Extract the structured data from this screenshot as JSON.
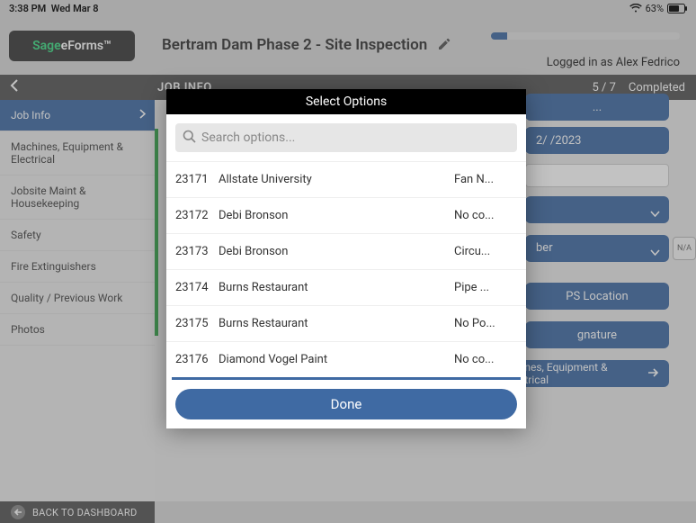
{
  "status": {
    "time": "3:38 PM",
    "date": "Wed Mar 8",
    "battery": "63%"
  },
  "app": {
    "logo_sage": "Sage",
    "logo_rest": " eForms™"
  },
  "page": {
    "title": "Bertram Dam Phase 2 - Site Inspection",
    "logged_in": "Logged in as Alex Fedrico"
  },
  "topbar": {
    "section": "JOB INFO",
    "progress": "5 / 7",
    "status": "Completed"
  },
  "sidebar": {
    "items": [
      {
        "label": "Job Info",
        "active": true
      },
      {
        "label": "Machines, Equipment & Electrical"
      },
      {
        "label": "Jobsite Maint & Housekeeping"
      },
      {
        "label": "Safety"
      },
      {
        "label": "Fire Extinguishers"
      },
      {
        "label": "Quality / Previous Work"
      },
      {
        "label": "Photos"
      }
    ]
  },
  "main": {
    "date_value": "2/   /2023",
    "select2_partial": "ber",
    "na": "N/A",
    "gps": "PS Location",
    "sig": "gnature",
    "next": "achines, Equipment & Electrical",
    "ellipsis": "..."
  },
  "modal": {
    "title": "Select Options",
    "search_placeholder": "Search options...",
    "rows": [
      {
        "id": "23171",
        "name": "Allstate University",
        "desc": "Fan N..."
      },
      {
        "id": "23172",
        "name": "Debi Bronson",
        "desc": "No co..."
      },
      {
        "id": "23173",
        "name": "Debi Bronson",
        "desc": "Circu..."
      },
      {
        "id": "23174",
        "name": "Burns Restaurant",
        "desc": "Pipe ..."
      },
      {
        "id": "23175",
        "name": "Burns Restaurant",
        "desc": "No Po..."
      },
      {
        "id": "23176",
        "name": "Diamond Vogel Paint",
        "desc": "No co..."
      }
    ],
    "done": "Done"
  },
  "footer": {
    "back": "BACK TO DASHBOARD"
  }
}
